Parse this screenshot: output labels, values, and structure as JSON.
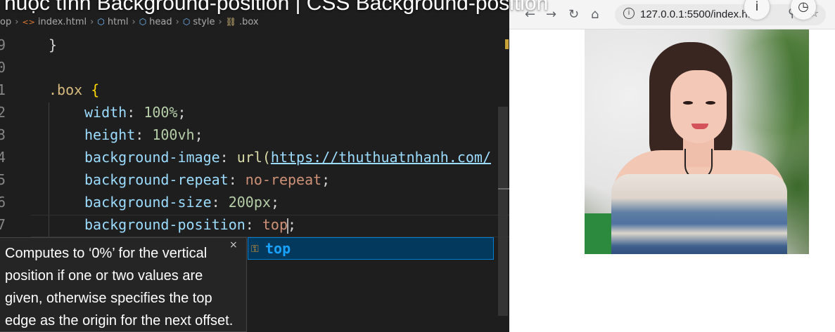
{
  "video_title": "huộc tính Background-position | CSS Background-position",
  "breadcrumb": {
    "root": "op",
    "file": "index.html",
    "html": "html",
    "head": "head",
    "style": "style",
    "selector": ".box"
  },
  "code": {
    "ln9": "9",
    "ln10": "0",
    "ln11": "1",
    "ln12": "2",
    "ln13": "3",
    "ln14": "4",
    "ln15": "5",
    "ln16": "6",
    "ln17": "7",
    "close_brace": "}",
    "selector": ".box",
    "open_brace": "{",
    "width_prop": "width",
    "width_val": "100%",
    "height_prop": "height",
    "height_val": "100vh",
    "bgimage_prop": "background-image",
    "bgimage_fn": "url(",
    "bgimage_url": "https://thuthuatnhanh.com/",
    "bgrepeat_prop": "background-repeat",
    "bgrepeat_val": "no-repeat",
    "bgsize_prop": "background-size",
    "bgsize_val": "200px",
    "bgpos_prop": "background-position",
    "bgpos_val": "top",
    "colon": ":",
    "semicolon": ";"
  },
  "suggest": {
    "item": "top"
  },
  "docs": {
    "text": "Computes to ‘0%’ for the vertical position if one or two values are given, otherwise specifies the top edge as the origin for the next offset.",
    "close": "×"
  },
  "browser": {
    "address": "127.0.0.1:5500/index.html",
    "back_icon": "arrow-left-icon",
    "forward_icon": "arrow-right-icon",
    "reload_icon": "reload-icon",
    "home_icon": "home-icon"
  }
}
